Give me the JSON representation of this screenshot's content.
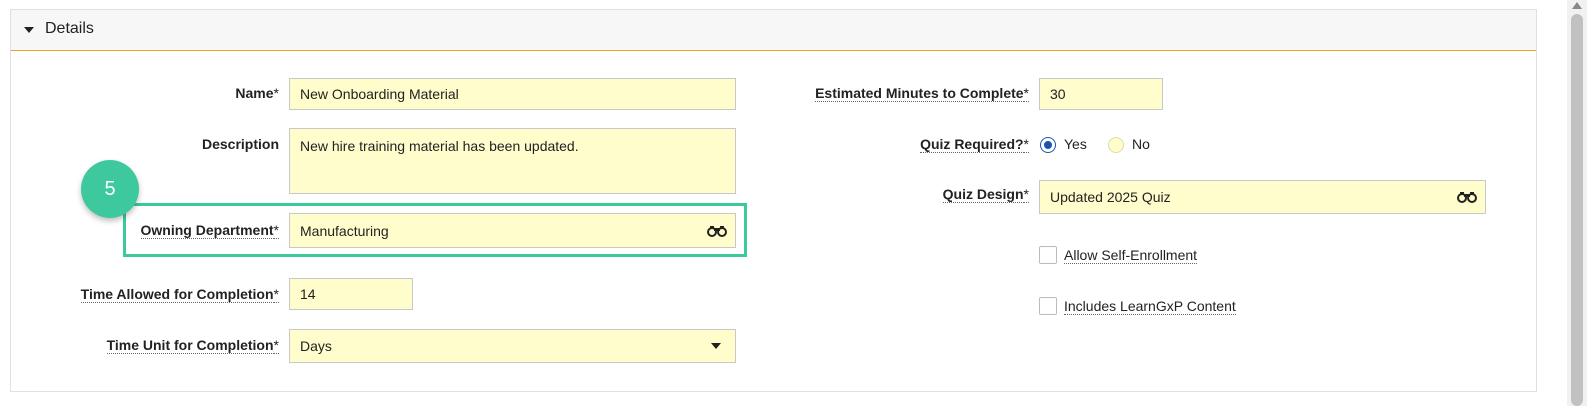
{
  "section": {
    "title": "Details"
  },
  "fields": {
    "name": {
      "label": "Name",
      "required": "*",
      "value": "New Onboarding Material"
    },
    "description": {
      "label": "Description",
      "value": "New hire training material has been updated."
    },
    "owning_department": {
      "label": "Owning Department",
      "required": "*",
      "value": "Manufacturing",
      "lookup_icon": "binoculars-icon"
    },
    "time_allowed": {
      "label": "Time Allowed for Completion",
      "required": "*",
      "value": "14"
    },
    "time_unit": {
      "label": "Time Unit for Completion",
      "required": "*",
      "selected": "Days"
    },
    "estimated_minutes": {
      "label": "Estimated Minutes to Complete",
      "required": "*",
      "value": "30"
    },
    "quiz_required": {
      "label": "Quiz Required?",
      "required": "*",
      "options": [
        "Yes",
        "No"
      ],
      "selected": "Yes"
    },
    "quiz_design": {
      "label": "Quiz Design",
      "required": "*",
      "value": "Updated 2025 Quiz",
      "lookup_icon": "binoculars-icon"
    },
    "allow_self_enrollment": {
      "label": "Allow Self-Enrollment",
      "checked": false
    },
    "includes_learngxp": {
      "label": "Includes LearnGxP Content",
      "checked": false
    }
  },
  "callout": {
    "step": "5",
    "color": "#3ec89e"
  },
  "colors": {
    "field_bg": "#fffdcc",
    "header_rule": "#f0a030",
    "radio_selected": "#1a56b0"
  }
}
